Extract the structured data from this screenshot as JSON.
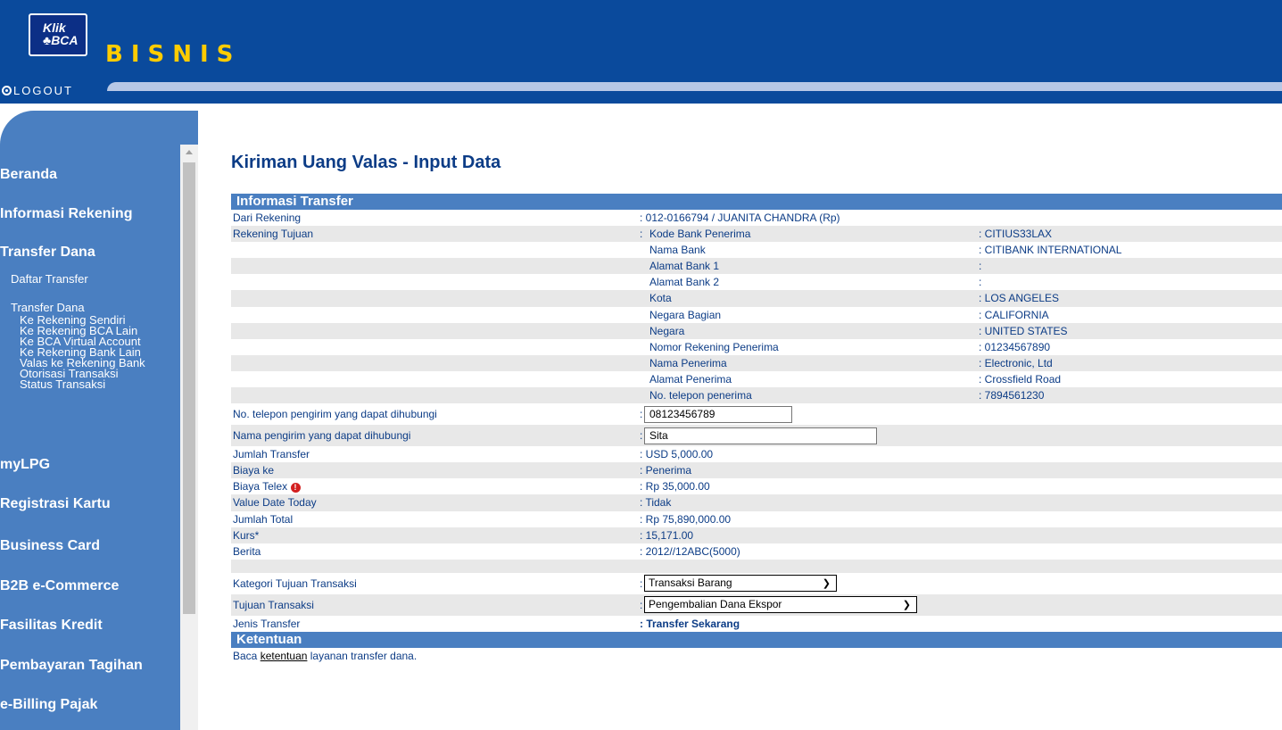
{
  "header": {
    "logo_line1": "Klik",
    "logo_line2": "♣BCA",
    "brand": "BISNIS",
    "logout_label": "LOGOUT"
  },
  "sidebar": {
    "items": [
      {
        "label": "Beranda"
      },
      {
        "label": "Informasi Rekening"
      },
      {
        "label": "Transfer Dana"
      },
      {
        "label": "Daftar Transfer"
      },
      {
        "label": "Transfer Dana"
      },
      {
        "label": "Ke Rekening Sendiri"
      },
      {
        "label": "Ke Rekening BCA Lain"
      },
      {
        "label": "Ke BCA Virtual Account"
      },
      {
        "label": "Ke Rekening Bank Lain"
      },
      {
        "label": "Valas ke Rekening Bank"
      },
      {
        "label": "Otorisasi Transaksi"
      },
      {
        "label": "Status Transaksi"
      },
      {
        "label": "myLPG"
      },
      {
        "label": "Registrasi Kartu"
      },
      {
        "label": "Business Card"
      },
      {
        "label": "B2B e-Commerce"
      },
      {
        "label": "Fasilitas Kredit"
      },
      {
        "label": "Pembayaran Tagihan"
      },
      {
        "label": "e-Billing Pajak"
      }
    ]
  },
  "page": {
    "title": "Kiriman Uang Valas - Input Data"
  },
  "transfer": {
    "section_title": "Informasi Transfer",
    "dari_rekening_label": "Dari Rekening",
    "dari_rekening_value": ": 012-0166794 / JUANITA CHANDRA (Rp)",
    "rekening_tujuan_label": "Rekening Tujuan",
    "colon": ":",
    "dest": [
      {
        "label": "Kode Bank Penerima",
        "value": ": CITIUS33LAX"
      },
      {
        "label": "Nama Bank",
        "value": ": CITIBANK INTERNATIONAL"
      },
      {
        "label": "Alamat Bank 1",
        "value": ":"
      },
      {
        "label": "Alamat Bank 2",
        "value": ":"
      },
      {
        "label": "Kota",
        "value": ": LOS ANGELES"
      },
      {
        "label": "Negara Bagian",
        "value": ": CALIFORNIA"
      },
      {
        "label": "Negara",
        "value": ": UNITED STATES"
      },
      {
        "label": "Nomor Rekening Penerima",
        "value": ": 01234567890"
      },
      {
        "label": "Nama Penerima",
        "value": ": Electronic, Ltd"
      },
      {
        "label": "Alamat Penerima",
        "value": ": Crossfield Road"
      },
      {
        "label": "No. telepon penerima",
        "value": ": 7894561230"
      }
    ],
    "phone_label": "No. telepon pengirim yang dapat dihubungi",
    "phone_value": "08123456789",
    "sender_name_label": "Nama pengirim yang dapat dihubungi",
    "sender_name_value": "Sita",
    "details": [
      {
        "label": "Jumlah Transfer",
        "value": ": USD 5,000.00"
      },
      {
        "label": "Biaya ke",
        "value": ": Penerima"
      },
      {
        "label": "Biaya Telex",
        "value": ": Rp 35,000.00"
      },
      {
        "label": "Value Date Today",
        "value": ": Tidak"
      },
      {
        "label": "Jumlah Total",
        "value": ": Rp 75,890,000.00"
      },
      {
        "label": "Kurs*",
        "value": ": 15,171.00"
      },
      {
        "label": "Berita",
        "value": ": 2012//12ABC(5000)"
      }
    ],
    "kategori_label": "Kategori Tujuan Transaksi",
    "kategori_value": "Transaksi Barang",
    "tujuan_label": "Tujuan Transaksi",
    "tujuan_value": "Pengembalian Dana Ekspor",
    "jenis_label": "Jenis Transfer",
    "jenis_value": ": Transfer Sekarang",
    "info_icon_glyph": "!"
  },
  "ketentuan": {
    "section_title": "Ketentuan",
    "text_before": "Baca",
    "link_text": "ketentuan",
    "text_after": "layanan transfer dana."
  },
  "colors": {
    "header_blue": "#0a4a9c",
    "sidebar_blue": "#4a7fc1",
    "brand_yellow": "#ffcc00",
    "text_navy": "#0c3c86"
  }
}
